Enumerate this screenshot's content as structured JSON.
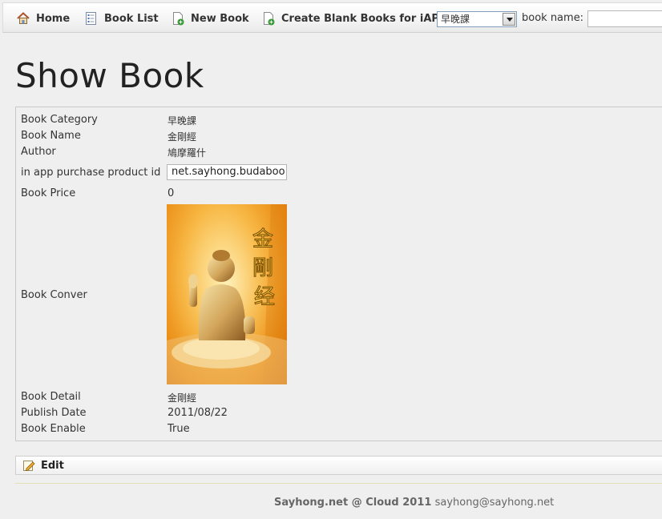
{
  "toolbar": {
    "home_label": "Home",
    "book_list_label": "Book List",
    "new_book_label": "New Book",
    "create_blank_label": "Create Blank Books for iAP",
    "category_select_value": "早晚課",
    "book_name_label": "book name:",
    "book_name_value": ""
  },
  "page_title": "Show Book",
  "details": {
    "category": {
      "label": "Book Category",
      "value": "早晚課"
    },
    "name": {
      "label": "Book Name",
      "value": "金剛經"
    },
    "author": {
      "label": "Author",
      "value": "鳩摩羅什"
    },
    "product_id": {
      "label": "in app purchase product id",
      "value": "net.sayhong.budaboo"
    },
    "price": {
      "label": "Book Price",
      "value": "0"
    },
    "cover": {
      "label": "Book Conver",
      "title_text": "金剛经"
    },
    "detail": {
      "label": "Book Detail",
      "value": "金剛經"
    },
    "publish_date": {
      "label": "Publish Date",
      "value": "2011/08/22"
    },
    "enable": {
      "label": "Book Enable",
      "value": "True"
    }
  },
  "actions": {
    "edit_label": "Edit"
  },
  "footer": {
    "brand": "Sayhong.net @ Cloud 2011",
    "email": "sayhong@sayhong.net"
  },
  "icons": {
    "home": "home-icon",
    "book_list": "list-document-icon",
    "new_book": "document-add-icon",
    "create_blank": "document-add-icon",
    "edit": "pencil-edit-icon"
  },
  "colors": {
    "background": "#efefef",
    "cover_orange": "#e98a14",
    "cover_gold": "#c8a020"
  }
}
